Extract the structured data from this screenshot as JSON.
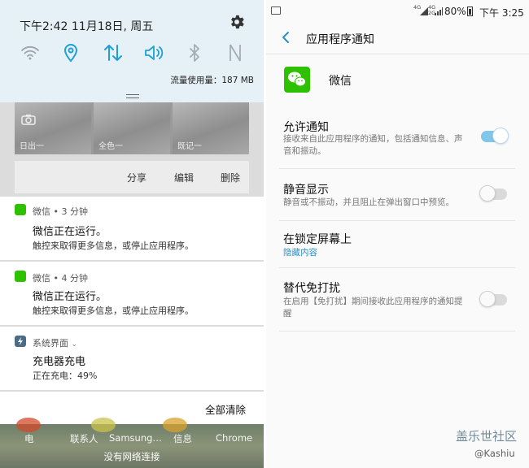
{
  "left": {
    "status": {
      "datetime": "下午2:42  11月18日, 周五"
    },
    "quick_icons": [
      "wifi-icon",
      "location-icon",
      "data-sync-icon",
      "sound-icon",
      "bluetooth-icon",
      "nfc-icon"
    ],
    "data_usage": "流量使用量：187 MB",
    "screenshot_thumbs": [
      "日出一",
      "全色一",
      "既记一"
    ],
    "screenshot_actions": {
      "share": "分享",
      "edit": "编辑",
      "delete": "删除"
    },
    "notifications": [
      {
        "app": "微信 • 3 分钟",
        "title": "微信正在运行。",
        "body": "触控来取得更多信息，或停止应用程序。",
        "color": "#2dc100"
      },
      {
        "app": "微信 • 4 分钟",
        "title": "微信正在运行。",
        "body": "触控来取得更多信息，或停止应用程序。",
        "color": "#2dc100"
      },
      {
        "app": "系统界面",
        "title": "充电器充电",
        "body": "正在充电：49%",
        "color": "#4a6c86"
      }
    ],
    "clear_all": "全部清除",
    "dock_apps": [
      "电",
      "联系人",
      "Samsung…",
      "信息",
      "Chrome"
    ],
    "no_network": "没有网络连接"
  },
  "right": {
    "status": {
      "net_top": "4G",
      "net_mid": "4G",
      "net_mid2": "2G",
      "battery": "80%",
      "time": "下午 3:25"
    },
    "title": "应用程序通知",
    "app_name": "微信",
    "settings": [
      {
        "title": "允许通知",
        "subtitle": "接收来自此应用程序的通知，包括通知信息、声音和振动。",
        "enabled": true
      },
      {
        "title": "静音显示",
        "subtitle": "静音或不振动，并且阻止在弹出窗口中预览。",
        "enabled": false
      },
      {
        "title": "在锁定屏幕上",
        "subtitle": "隐藏内容"
      },
      {
        "title": "替代免打扰",
        "subtitle": "在启用【免打扰】期间接收此应用程序的通知提醒",
        "enabled": false
      }
    ],
    "watermark": "盖乐世社区",
    "watermark_user": "@Kashiu"
  },
  "colors": {
    "accent": "#2a8fc9",
    "toggle_on": "#82c6ea",
    "wechat_green": "#2dc100",
    "quick_panel_bg": "#e6f1f7"
  }
}
